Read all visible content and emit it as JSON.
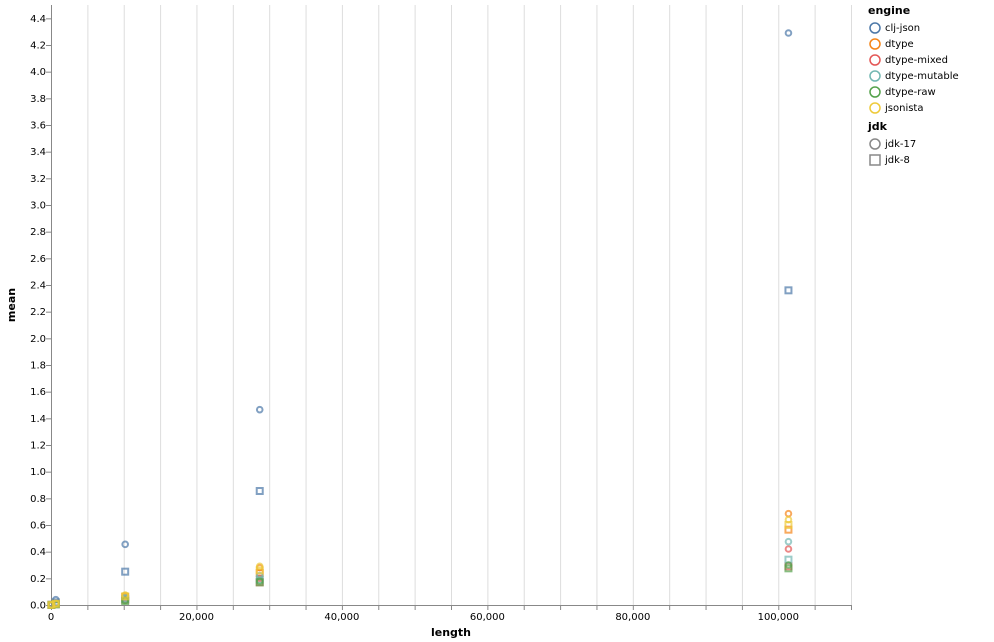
{
  "chart_data": {
    "type": "scatter",
    "xlabel": "length",
    "ylabel": "mean",
    "xlim": [
      0,
      110000
    ],
    "ylim": [
      0,
      4.5
    ],
    "x_ticks": [
      0,
      20000,
      40000,
      60000,
      80000,
      100000
    ],
    "x_tick_labels": [
      "0",
      "20,000",
      "40,000",
      "60,000",
      "80,000",
      "100,000"
    ],
    "y_ticks": [
      0,
      0.2,
      0.4,
      0.6,
      0.8,
      1.0,
      1.2,
      1.4,
      1.6,
      1.8,
      2.0,
      2.2,
      2.4,
      2.6,
      2.8,
      3.0,
      3.2,
      3.4,
      3.6,
      3.8,
      4.0,
      4.2,
      4.4
    ],
    "y_tick_labels": [
      "0.0",
      "0.2",
      "0.4",
      "0.6",
      "0.8",
      "1.0",
      "1.2",
      "1.4",
      "1.6",
      "1.8",
      "2.0",
      "2.2",
      "2.4",
      "2.6",
      "2.8",
      "3.0",
      "3.2",
      "3.4",
      "3.6",
      "3.8",
      "4.0",
      "4.2",
      "4.4"
    ],
    "grid": "vertical",
    "legend_placement": "right",
    "legends": [
      {
        "title": "engine",
        "channel": "color",
        "items": [
          {
            "label": "clj-json",
            "color": "#4c78a8"
          },
          {
            "label": "dtype",
            "color": "#f58518"
          },
          {
            "label": "dtype-mixed",
            "color": "#e45756"
          },
          {
            "label": "dtype-mutable",
            "color": "#72b7b2"
          },
          {
            "label": "dtype-raw",
            "color": "#54a24b"
          },
          {
            "label": "jsonista",
            "color": "#eeca3b"
          }
        ]
      },
      {
        "title": "jdk",
        "channel": "shape",
        "items": [
          {
            "label": "jdk-17",
            "shape": "circle"
          },
          {
            "label": "jdk-8",
            "shape": "square"
          }
        ]
      }
    ],
    "series": [
      {
        "engine": "clj-json",
        "jdk": "jdk-17",
        "x": [
          60,
          660,
          10200,
          28700,
          101400
        ],
        "y": [
          0.0025,
          0.04,
          0.455,
          1.465,
          4.29
        ]
      },
      {
        "engine": "clj-json",
        "jdk": "jdk-8",
        "x": [
          60,
          660,
          10200,
          28700,
          101400
        ],
        "y": [
          0.0015,
          0.02,
          0.25,
          0.855,
          2.36
        ]
      },
      {
        "engine": "dtype",
        "jdk": "jdk-17",
        "x": [
          60,
          660,
          10200,
          28700,
          101400
        ],
        "y": [
          0.0008,
          0.01,
          0.07,
          0.28,
          0.685
        ]
      },
      {
        "engine": "dtype",
        "jdk": "jdk-8",
        "x": [
          60,
          660,
          10200,
          28700,
          101400
        ],
        "y": [
          0.0008,
          0.008,
          0.06,
          0.24,
          0.565
        ]
      },
      {
        "engine": "dtype-mixed",
        "jdk": "jdk-17",
        "x": [
          60,
          660,
          10200,
          28700,
          101400
        ],
        "y": [
          0.0007,
          0.008,
          0.05,
          0.2,
          0.42
        ]
      },
      {
        "engine": "dtype-mixed",
        "jdk": "jdk-8",
        "x": [
          60,
          660,
          10200,
          28700,
          101400
        ],
        "y": [
          0.0006,
          0.006,
          0.04,
          0.17,
          0.29
        ]
      },
      {
        "engine": "dtype-mutable",
        "jdk": "jdk-17",
        "x": [
          60,
          660,
          10200,
          28700,
          101400
        ],
        "y": [
          0.0007,
          0.009,
          0.055,
          0.22,
          0.475
        ]
      },
      {
        "engine": "dtype-mutable",
        "jdk": "jdk-8",
        "x": [
          60,
          660,
          10200,
          28700,
          101400
        ],
        "y": [
          0.0006,
          0.007,
          0.045,
          0.19,
          0.34
        ]
      },
      {
        "engine": "dtype-raw",
        "jdk": "jdk-17",
        "x": [
          60,
          660,
          10200,
          28700,
          101400
        ],
        "y": [
          0.0006,
          0.006,
          0.035,
          0.18,
          0.3
        ]
      },
      {
        "engine": "dtype-raw",
        "jdk": "jdk-8",
        "x": [
          60,
          660,
          10200,
          28700,
          101400
        ],
        "y": [
          0.0005,
          0.005,
          0.03,
          0.17,
          0.275
        ]
      },
      {
        "engine": "jsonista",
        "jdk": "jdk-17",
        "x": [
          60,
          660,
          10200,
          28700,
          101400
        ],
        "y": [
          0.0009,
          0.011,
          0.075,
          0.29,
          0.64
        ]
      },
      {
        "engine": "jsonista",
        "jdk": "jdk-8",
        "x": [
          60,
          660,
          10200,
          28700,
          101400
        ],
        "y": [
          0.0008,
          0.009,
          0.065,
          0.26,
          0.6
        ]
      }
    ]
  }
}
